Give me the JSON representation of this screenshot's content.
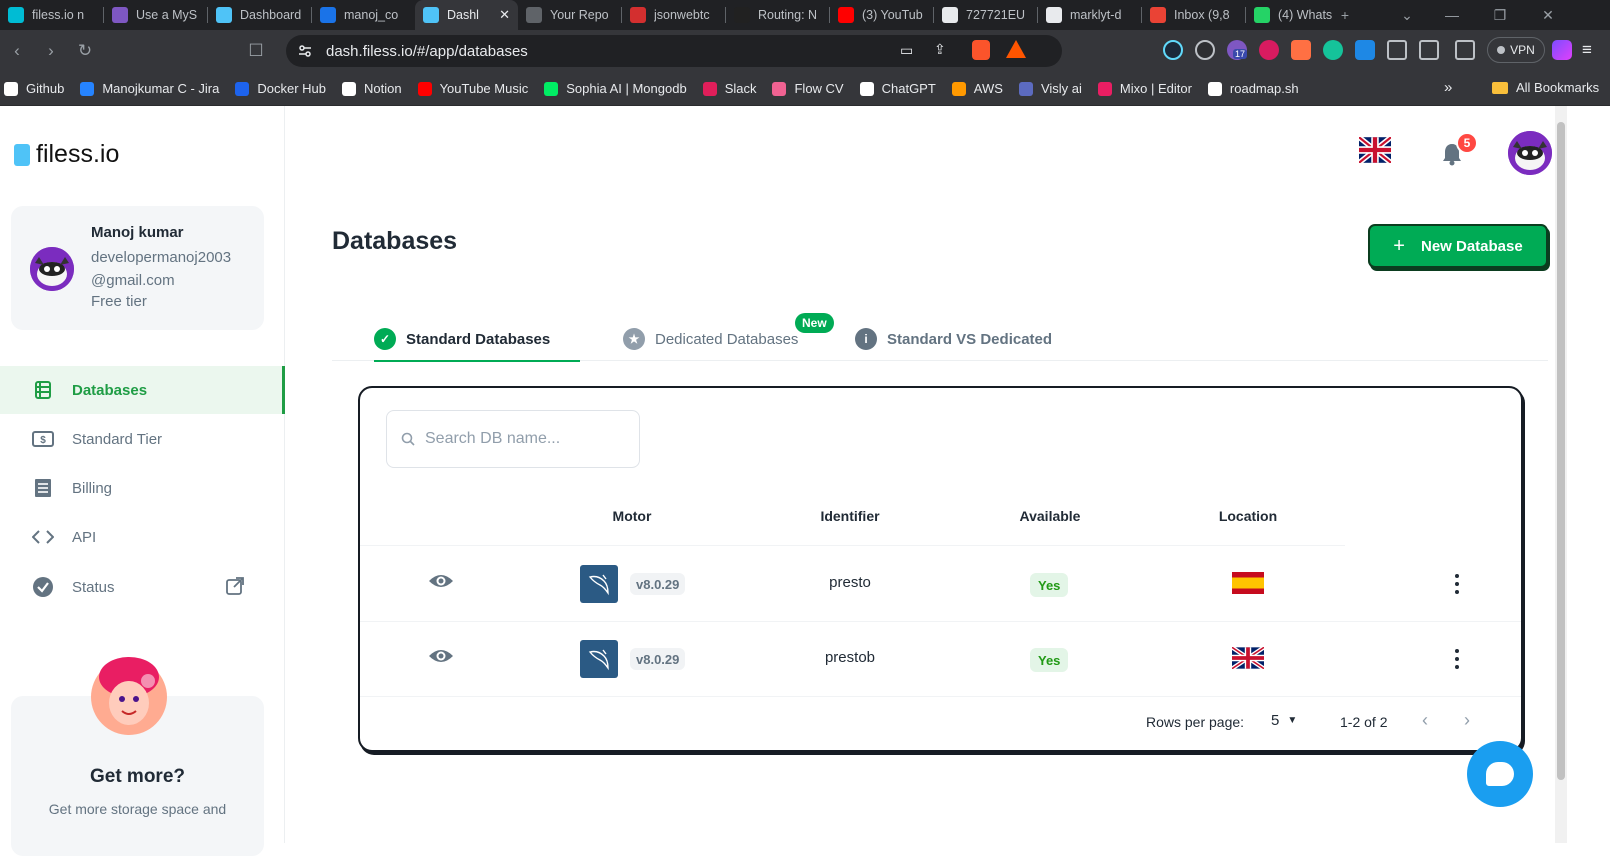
{
  "browser": {
    "tabs": [
      {
        "title": "filess.io n",
        "color": "#00bcd4"
      },
      {
        "title": "Use a MyS",
        "color": "#7e57c2"
      },
      {
        "title": "Dashboard",
        "color": "#4fc3f7"
      },
      {
        "title": "manoj_co",
        "color": "#1a73e8"
      },
      {
        "title": "Dashl",
        "color": "#4fc3f7",
        "active": true
      },
      {
        "title": "Your Repo",
        "color": "#5f6368"
      },
      {
        "title": "jsonwebtc",
        "color": "#d32f2f"
      },
      {
        "title": "Routing: N",
        "color": "#212121"
      },
      {
        "title": "(3) YouTub",
        "color": "#ff0000"
      },
      {
        "title": "727721EU",
        "color": "#e8eaed"
      },
      {
        "title": "marklyt-d",
        "color": "#e8eaed"
      },
      {
        "title": "Inbox (9,8",
        "color": "#ea4335"
      },
      {
        "title": "(4) Whats",
        "color": "#25d366"
      }
    ],
    "url": "dash.filess.io/#/app/databases",
    "extension_badge": "17",
    "vpn_label": "VPN",
    "bookmarks": [
      {
        "label": "Github",
        "color": "#ffffff"
      },
      {
        "label": "Manojkumar C - Jira",
        "color": "#2684ff"
      },
      {
        "label": "Docker Hub",
        "color": "#1d63ed"
      },
      {
        "label": "Notion",
        "color": "#ffffff"
      },
      {
        "label": "YouTube Music",
        "color": "#ff0000"
      },
      {
        "label": "Sophia AI | Mongodb",
        "color": "#00ed64"
      },
      {
        "label": "Slack",
        "color": "#e01e5a"
      },
      {
        "label": "Flow CV",
        "color": "#f06292"
      },
      {
        "label": "ChatGPT",
        "color": "#ffffff"
      },
      {
        "label": "AWS",
        "color": "#ff9900"
      },
      {
        "label": "Visly ai",
        "color": "#5c6bc0"
      },
      {
        "label": "Mixo | Editor",
        "color": "#e91e63"
      },
      {
        "label": "roadmap.sh",
        "color": "#ffffff"
      }
    ],
    "all_bookmarks": "All Bookmarks"
  },
  "sidebar": {
    "logo": "filess.io",
    "user": {
      "name": "Manoj kumar",
      "email_line1": "developermanoj2003",
      "email_line2": "@gmail.com",
      "tier": "Free tier"
    },
    "nav": [
      {
        "label": "Databases",
        "icon": "database-icon",
        "active": true
      },
      {
        "label": "Standard Tier",
        "icon": "dollar-icon"
      },
      {
        "label": "Billing",
        "icon": "receipt-icon"
      },
      {
        "label": "API",
        "icon": "code-icon"
      },
      {
        "label": "Status",
        "icon": "check-circle-icon"
      }
    ],
    "promo": {
      "title": "Get more?",
      "desc": "Get more storage space and"
    }
  },
  "header": {
    "notifications": "5"
  },
  "page": {
    "title": "Databases",
    "new_button": "New Database",
    "tabs": [
      {
        "label": "Standard Databases",
        "active": true
      },
      {
        "label": "Dedicated Databases",
        "tag": "New"
      },
      {
        "label": "Standard VS Dedicated"
      }
    ],
    "search_placeholder": "Search DB name...",
    "columns": [
      "Motor",
      "Identifier",
      "Available",
      "Location"
    ],
    "rows": [
      {
        "version": "v8.0.29",
        "identifier": "presto",
        "available": "Yes",
        "location": "spain-flag"
      },
      {
        "version": "v8.0.29",
        "identifier": "prestob",
        "available": "Yes",
        "location": "uk-flag"
      }
    ],
    "footer": {
      "rows_per_page_label": "Rows per page:",
      "rows_per_page": "5",
      "range": "1-2 of 2"
    }
  },
  "colors": {
    "accent": "#00ab55",
    "chat": "#1a9ef0"
  }
}
